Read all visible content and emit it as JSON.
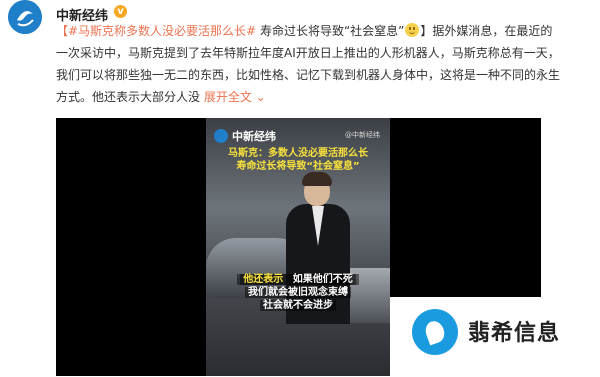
{
  "post": {
    "account_name": "中新经纬",
    "verified_badge": "v",
    "topic": "【#马斯克称多数人没必要活那么长#",
    "headline": " 寿命过长将导致“社会窒息”",
    "emoji_icon": "smile-icon",
    "headline_end": "】据外媒消息，在最近的",
    "line2": "一次采访中，马斯克提到了去年特斯拉年度AI开放日上推出的人形机器人，马斯克称总有一天，",
    "line3": "我们可以将那些独一无二的东西，比如性格、记忆下载到机器人身体中，这将是一种不同的永生",
    "line4": "方式。他还表示大部分人没 ",
    "expand_label": "展开全文",
    "expand_icon": "chevron-down-icon"
  },
  "video": {
    "brand": "中新经纬",
    "small_watermark": "@中新经纬",
    "caption_top_1": "马斯克：多数人没必要活那么长",
    "caption_top_2": "寿命过长将导致“社会窒息”",
    "caption_bottom_1a": "他还表示",
    "caption_bottom_1b": "如果他们不死",
    "caption_bottom_2": "我们就会被旧观念束缚",
    "caption_bottom_3": "社会就不会进步"
  },
  "site_watermark": {
    "name": "翡希信息"
  },
  "colors": {
    "link": "#eb7350",
    "caption_yellow": "#f8e13b",
    "brand_blue": "#1f7fc9"
  }
}
